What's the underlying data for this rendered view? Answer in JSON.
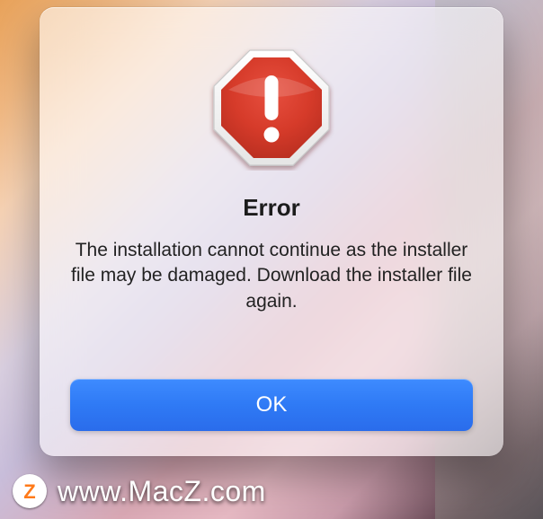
{
  "dialog": {
    "icon_name": "stop-alert-icon",
    "title": "Error",
    "message": "The installation cannot continue as the installer file may be damaged. Download the installer file again.",
    "ok_label": "OK"
  },
  "watermark": {
    "glyph": "Z",
    "text": "www.MacZ.com"
  }
}
